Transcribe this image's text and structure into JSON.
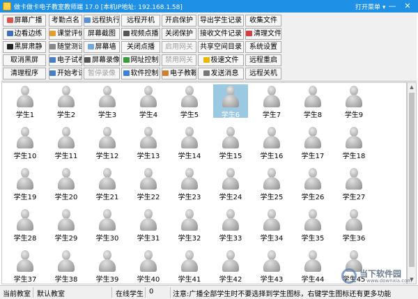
{
  "window": {
    "title": "做卡做卡电子教室教师端 17.0 [本机IP地址: 192.168.1.58]",
    "menu_label": "打开菜单 ▾",
    "minimize": "—",
    "close": "✕"
  },
  "toolbar": {
    "rows": [
      [
        {
          "label": "屏幕广播",
          "icon": "broadcast-icon",
          "color": "#d9534f"
        },
        {
          "label": "考勤点名"
        },
        {
          "label": "远程执行",
          "icon": "remote-exec-icon",
          "color": "#5b8fd6"
        },
        {
          "label": "远程开机"
        },
        {
          "label": "开启保护"
        },
        {
          "label": "导出学生记录"
        },
        {
          "label": "收集文件"
        }
      ],
      [
        {
          "label": "边看边练",
          "icon": "practice-icon",
          "color": "#3f6fb8"
        },
        {
          "label": "课堂评价",
          "icon": "evaluate-icon",
          "color": "#e0a030"
        },
        {
          "label": "屏幕截图"
        },
        {
          "label": "视频点播",
          "icon": "video-icon",
          "color": "#555555"
        },
        {
          "label": "关闭保护"
        },
        {
          "label": "接收文件记录"
        },
        {
          "label": "清理文件",
          "icon": "clean-icon",
          "color": "#d04040"
        }
      ],
      [
        {
          "label": "黑屏肃静",
          "icon": "blackscreen-icon",
          "color": "#222222"
        },
        {
          "label": "随堂测试",
          "icon": "test-icon",
          "color": "#888888"
        },
        {
          "label": "屏幕墙",
          "icon": "screen-wall-icon",
          "color": "#6fa8dc"
        },
        {
          "label": "关闭点播"
        },
        {
          "label": "启用网关",
          "disabled": true
        },
        {
          "label": "共享空间目录"
        },
        {
          "label": "系统设置"
        }
      ],
      [
        {
          "label": "取消黑屏"
        },
        {
          "label": "电子试卷",
          "icon": "exam-paper-icon",
          "color": "#4a7fc1"
        },
        {
          "label": "屏幕录像",
          "icon": "record-icon",
          "color": "#555555"
        },
        {
          "label": "网址控制",
          "icon": "url-control-icon",
          "color": "#3b9a3b"
        },
        {
          "label": "禁用网关",
          "disabled": true
        },
        {
          "label": "极速文件",
          "icon": "fast-file-icon",
          "color": "#e6b800"
        },
        {
          "label": "远程重启"
        }
      ],
      [
        {
          "label": "清理程序"
        },
        {
          "label": "开始考试",
          "icon": "start-exam-icon",
          "color": "#4a7fc1"
        },
        {
          "label": "暂停录像",
          "disabled": true
        },
        {
          "label": "软件控制",
          "icon": "software-control-icon",
          "color": "#3b7fd6"
        },
        {
          "label": "电子教鞭",
          "icon": "pointer-icon",
          "color": "#d08030"
        },
        {
          "label": "发送消息",
          "icon": "message-icon",
          "color": "#777777"
        },
        {
          "label": "远程关机"
        }
      ]
    ]
  },
  "students": {
    "prefix": "学生",
    "count": 45,
    "selected": 6
  },
  "status": {
    "current_classroom_label": "当前教室",
    "current_classroom_value": "默认教室",
    "online_label": "在线学生",
    "online_count": "0",
    "hint": "注意:广播全部学生时不要选择到学生图标，右键学生图标还有更多功能"
  },
  "watermark": {
    "text": "当下软件园",
    "url": "www.downxia.com"
  }
}
